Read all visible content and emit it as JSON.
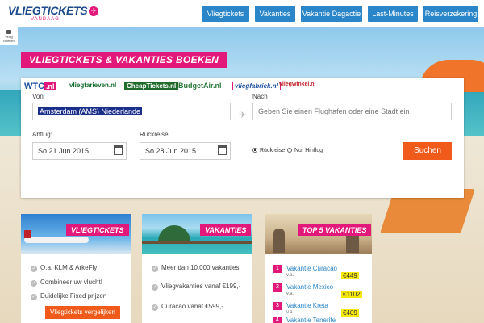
{
  "header": {
    "logo_main": "VLIEGTICKETS",
    "logo_sub": "VANDAAG",
    "nav": [
      "Vliegtickets",
      "Vakanties",
      "Vakantie Dagactie",
      "Last-Minutes",
      "Reisverzekering"
    ]
  },
  "safety_badge": "Veilig Boeken",
  "banner_title": "VLIEGTICKETS & VAKANTIES BOEKEN",
  "brands": [
    "WTC.nl",
    "vliegtarieven.nl",
    "CheapTickets.nl",
    "BudgetAir.nl",
    "vliegfabriek.nl",
    "vliegwinkel.nl"
  ],
  "search": {
    "from_label": "Von",
    "from_value": "Amsterdam (AMS) Niederlande",
    "to_label": "Nach",
    "to_placeholder": "Geben Sie einen Flughafen oder eine Stadt ein",
    "depart_label": "Abflug:",
    "depart_value": "So 21 Jun 2015",
    "return_label": "Rückreise",
    "return_value": "So 28 Jun 2015",
    "trip_options": [
      "Rückreise",
      "Nur Hinflug"
    ],
    "selected_trip": "Rückreise",
    "search_button": "Suchen"
  },
  "cards": {
    "flights": {
      "title": "VLIEGTICKETS",
      "items": [
        "O.a. KLM & ArkeFly",
        "Combineer uw vlucht!",
        "Duidelijke Fixed prijzen"
      ],
      "button": "Vliegtickets vergelijken"
    },
    "holidays": {
      "title": "VAKANTIES",
      "items": [
        "Meer dan 10.000 vakanties!",
        "Vliegvakanties vanaf €199,-",
        "Curacao vanaf €599,-"
      ]
    },
    "top5": {
      "title": "TOP 5 VAKANTIES",
      "items": [
        {
          "num": "1",
          "name": "Vakantie Curacao",
          "sub": "v.a.",
          "price": "€449"
        },
        {
          "num": "2",
          "name": "Vakantie Mexico",
          "sub": "v.a.",
          "price": "€1102"
        },
        {
          "num": "3",
          "name": "Vakantie Kreta",
          "sub": "v.a.",
          "price": "€409"
        },
        {
          "num": "4",
          "name": "Vakantie Tenerife",
          "sub": "",
          "price": ""
        }
      ]
    }
  },
  "colors": {
    "brand_pink": "#e2187a",
    "nav_blue": "#2a86c9",
    "cta_orange": "#f05a1a",
    "price_yellow": "#f6e70c"
  }
}
